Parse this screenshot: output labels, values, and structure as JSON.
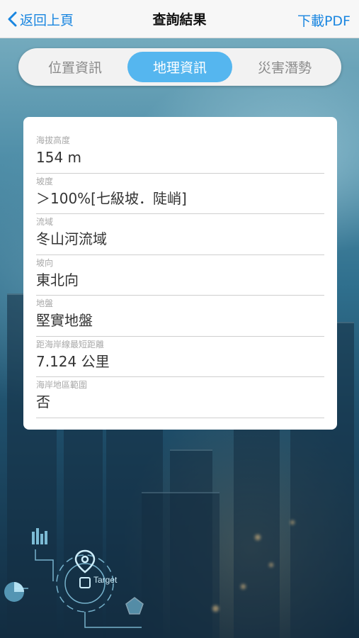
{
  "header": {
    "back_label": "返回上頁",
    "title": "查詢結果",
    "pdf_label": "下載PDF"
  },
  "tabs": [
    {
      "label": "位置資訊",
      "active": false
    },
    {
      "label": "地理資訊",
      "active": true
    },
    {
      "label": "災害潛勢",
      "active": false
    }
  ],
  "fields": [
    {
      "label": "海拔高度",
      "value": "154 m"
    },
    {
      "label": "坡度",
      "value": "＞100%[七級坡．陡峭]"
    },
    {
      "label": "流域",
      "value": "冬山河流域"
    },
    {
      "label": "坡向",
      "value": "東北向"
    },
    {
      "label": "地盤",
      "value": "堅實地盤"
    },
    {
      "label": "距海岸線最短距離",
      "value": "7.124 公里"
    },
    {
      "label": "海岸地區範圍",
      "value": "否"
    }
  ],
  "hud": {
    "target_label": "Target"
  },
  "colors": {
    "accent": "#1a86e0",
    "tab_active": "#55b6ef"
  }
}
